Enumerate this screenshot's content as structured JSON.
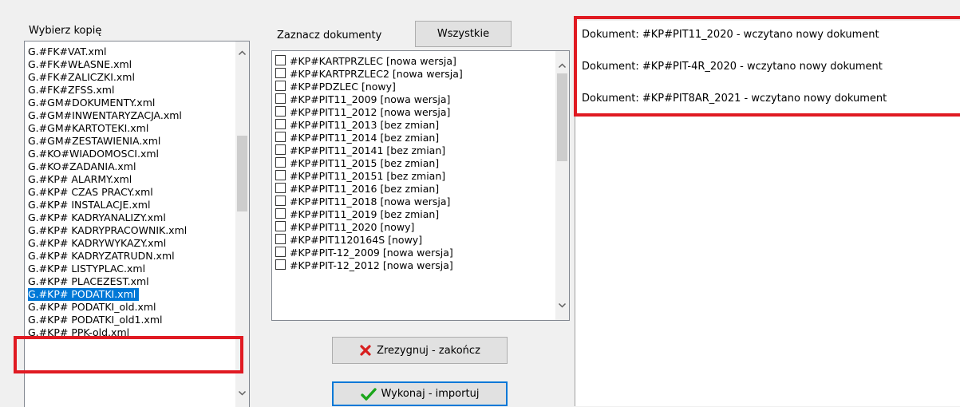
{
  "copies": {
    "label": "Wybierz kopię",
    "items": [
      "G.#FK#VAT.xml",
      "G.#FK#WŁASNE.xml",
      "G.#FK#ZALICZKI.xml",
      "G.#FK#ZFSS.xml",
      "G.#GM#DOKUMENTY.xml",
      "G.#GM#INWENTARYZACJA.xml",
      "G.#GM#KARTOTEKI.xml",
      "G.#GM#ZESTAWIENIA.xml",
      "G.#KO#WIADOMOSCI.xml",
      "G.#KO#ZADANIA.xml",
      "G.#KP# ALARMY.xml",
      "G.#KP# CZAS PRACY.xml",
      "G.#KP# INSTALACJE.xml",
      "G.#KP# KADRYANALIZY.xml",
      "G.#KP# KADRYPRACOWNIK.xml",
      "G.#KP# KADRYWYKAZY.xml",
      "G.#KP# KADRYZATRUDN.xml",
      "G.#KP# LISTYPLAC.xml",
      "G.#KP# PLACEZEST.xml",
      "G.#KP# PODATKI.xml",
      "G.#KP# PODATKI_old.xml",
      "G.#KP# PODATKI_old1.xml",
      "G.#KP# PPK-old.xml"
    ],
    "selected_index": 19
  },
  "documents": {
    "label": "Zaznacz dokumenty",
    "all_button": "Wszystkie",
    "items": [
      "#KP#KARTPRZLEC [nowa wersja]",
      "#KP#KARTPRZLEC2 [nowa wersja]",
      "#KP#PDZLEC [nowy]",
      "#KP#PIT11_2009 [nowa wersja]",
      "#KP#PIT11_2012 [nowa wersja]",
      "#KP#PIT11_2013 [bez zmian]",
      "#KP#PIT11_2014 [bez zmian]",
      "#KP#PIT11_20141 [bez zmian]",
      "#KP#PIT11_2015 [bez zmian]",
      "#KP#PIT11_20151 [bez zmian]",
      "#KP#PIT11_2016 [bez zmian]",
      "#KP#PIT11_2018 [nowa wersja]",
      "#KP#PIT11_2019 [bez zmian]",
      "#KP#PIT11_2020 [nowy]",
      "#KP#PIT1120164S [nowy]",
      "#KP#PIT-12_2009 [nowa wersja]",
      "#KP#PIT-12_2012 [nowa wersja]"
    ]
  },
  "buttons": {
    "cancel": "Zrezygnuj - zakończ",
    "execute": "Wykonaj - importuj"
  },
  "log": {
    "lines": [
      "Dokument: #KP#PIT11_2020 - wczytano nowy dokument",
      "Dokument: #KP#PIT-4R_2020 - wczytano nowy dokument",
      "Dokument: #KP#PIT8AR_2021 - wczytano nowy dokument"
    ]
  },
  "colors": {
    "highlight": "#e01a22",
    "selection": "#0078d7"
  }
}
